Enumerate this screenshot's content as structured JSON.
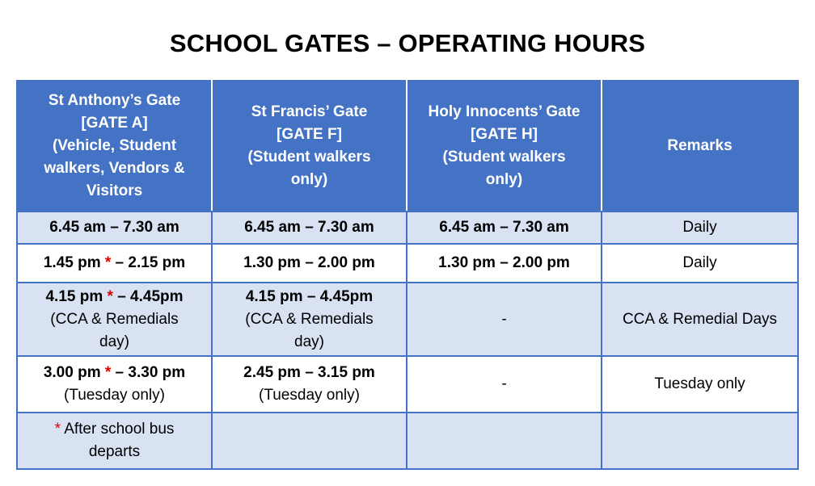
{
  "title": "SCHOOL GATES – OPERATING HOURS",
  "headers": {
    "gate_a": [
      "St Anthony’s Gate",
      "[GATE A]",
      "(Vehicle, Student",
      "walkers, Vendors &",
      "Visitors"
    ],
    "gate_f": [
      "St Francis’ Gate",
      "[GATE F]",
      "(Student walkers",
      "only)"
    ],
    "gate_h": [
      "Holy Innocents’ Gate",
      "[GATE H]",
      "(Student walkers",
      "only)"
    ],
    "remarks": "Remarks"
  },
  "rows": {
    "r1": {
      "a": "6.45 am – 7.30 am",
      "f": "6.45 am – 7.30 am",
      "h": "6.45 am – 7.30 am",
      "remarks": "Daily"
    },
    "r2": {
      "a_start": "1.45 pm ",
      "a_end": " – 2.15 pm",
      "f": "1.30 pm – 2.00 pm",
      "h": "1.30 pm – 2.00 pm",
      "remarks": "Daily"
    },
    "r3": {
      "a_start": "4.15 pm ",
      "a_end": " – 4.45pm",
      "a_note": [
        "(CCA & Remedials",
        "day)"
      ],
      "f": "4.15 pm – 4.45pm",
      "f_note": [
        "(CCA & Remedials",
        "day)"
      ],
      "h": "-",
      "remarks": "CCA & Remedial Days"
    },
    "r4": {
      "a_start": "3.00 pm ",
      "a_end": " – 3.30 pm",
      "a_note": "(Tuesday only)",
      "f": "2.45 pm – 3.15 pm",
      "f_note": "(Tuesday only)",
      "h": "-",
      "remarks": "Tuesday only"
    },
    "r5": {
      "footnote_1": " After school bus",
      "footnote_2": "departs"
    }
  },
  "asterisk": "*",
  "colors": {
    "header_bg": "#4472c4",
    "shade_bg": "#d9e2f3",
    "asterisk": "#e00000"
  }
}
